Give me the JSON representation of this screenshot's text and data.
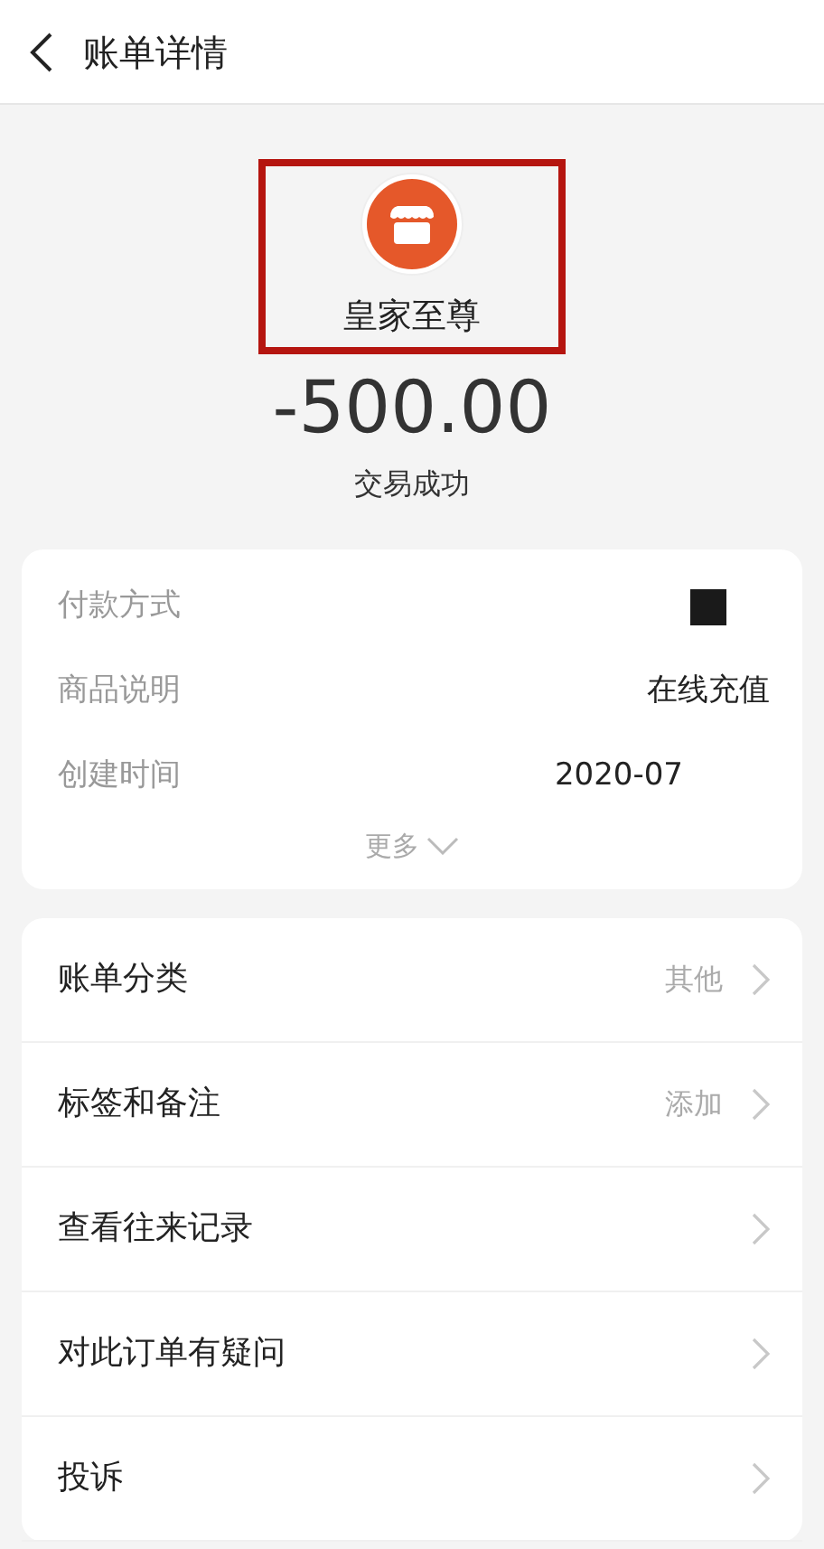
{
  "header": {
    "title": "账单详情"
  },
  "merchant": {
    "name": "皇家至尊",
    "highlighted": true
  },
  "amount": "-500.00",
  "status": "交易成功",
  "details": [
    {
      "label": "付款方式",
      "kind": "redacted"
    },
    {
      "label": "商品说明",
      "kind": "text",
      "value": "在线充值"
    },
    {
      "label": "创建时间",
      "kind": "text",
      "value": "2020-07"
    }
  ],
  "more": "更多",
  "actions": [
    {
      "label": "账单分类",
      "value": "其他"
    },
    {
      "label": "标签和备注",
      "value": "添加"
    },
    {
      "label": "查看往来记录"
    },
    {
      "label": "对此订单有疑问"
    },
    {
      "label": "投诉"
    }
  ]
}
